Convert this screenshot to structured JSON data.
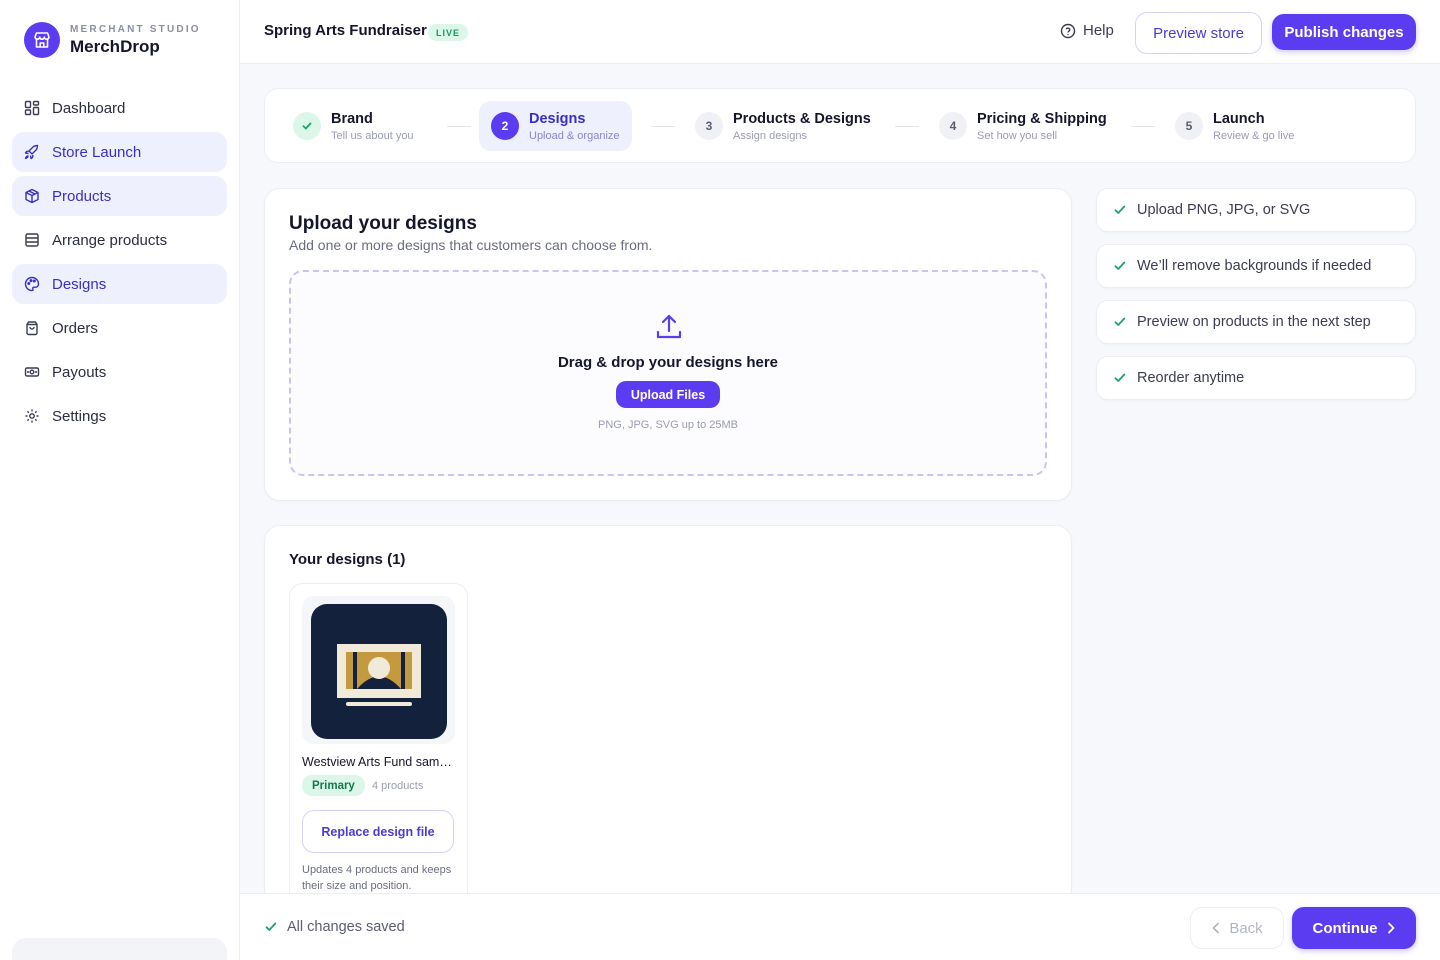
{
  "brand": {
    "eyebrow": "MERCHANT STUDIO",
    "name": "MerchDrop"
  },
  "nav": {
    "items": [
      {
        "label": "Dashboard",
        "icon": "dashboard-icon"
      },
      {
        "label": "Store Launch",
        "icon": "rocket-icon",
        "active": true
      },
      {
        "label": "Products",
        "icon": "box-icon",
        "active": true
      },
      {
        "label": "Arrange products",
        "icon": "list-icon"
      },
      {
        "label": "Designs",
        "icon": "palette-icon",
        "active": true
      },
      {
        "label": "Orders",
        "icon": "bag-icon"
      },
      {
        "label": "Payouts",
        "icon": "cash-icon"
      },
      {
        "label": "Settings",
        "icon": "gear-icon"
      }
    ]
  },
  "topbar": {
    "store_title": "Spring Arts Fundraiser",
    "status_badge": "LIVE",
    "help_label": "Help",
    "preview_label": "Preview store",
    "publish_label": "Publish changes"
  },
  "stepper": {
    "steps": [
      {
        "number": "1",
        "title": "Brand",
        "subtitle": "Tell us about you",
        "state": "done"
      },
      {
        "number": "2",
        "title": "Designs",
        "subtitle": "Upload & organize",
        "state": "current"
      },
      {
        "number": "3",
        "title": "Products & Designs",
        "subtitle": "Assign designs",
        "state": "todo"
      },
      {
        "number": "4",
        "title": "Pricing & Shipping",
        "subtitle": "Set how you sell",
        "state": "todo"
      },
      {
        "number": "5",
        "title": "Launch",
        "subtitle": "Review & go live",
        "state": "todo"
      }
    ]
  },
  "upload": {
    "title": "Upload your designs",
    "subtitle": "Add one or more designs that customers can choose from.",
    "drop_title": "Drag & drop your designs here",
    "button_label": "Upload Files",
    "hint": "PNG, JPG, SVG up to 25MB"
  },
  "tips": [
    "Upload PNG, JPG, or SVG",
    "We’ll remove backgrounds if needed",
    "Preview on products in the next step",
    "Reorder anytime"
  ],
  "designs": {
    "title": "Your designs (1)",
    "items": [
      {
        "name": "Westview Arts Fund sample logo",
        "badge": "Primary",
        "product_count": "4 products",
        "replace_label": "Replace design file",
        "note": "Updates 4 products and keeps their size and position."
      }
    ]
  },
  "footer": {
    "saved_label": "All changes saved",
    "back_label": "Back",
    "continue_label": "Continue"
  },
  "colors": {
    "accent": "#5b3cf0",
    "accent_soft": "#eef0fe",
    "success": "#1aa36b",
    "success_soft": "#dcf7ea",
    "thumb_bg": "#14213d",
    "thumb_gold": "#c59a3f"
  }
}
